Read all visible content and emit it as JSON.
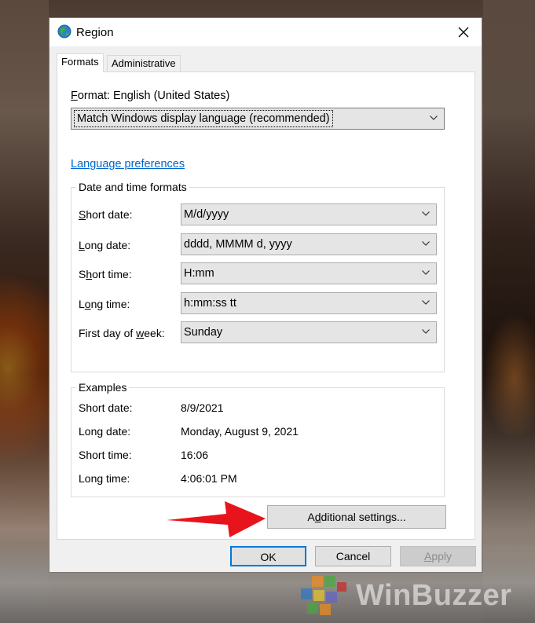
{
  "window": {
    "title": "Region",
    "icon": "globe-icon"
  },
  "tabs": [
    {
      "label": "Formats",
      "active": true
    },
    {
      "label": "Administrative",
      "active": false
    }
  ],
  "format": {
    "label_prefix": "F",
    "label_rest": "ormat: English (United States)",
    "selected": "Match Windows display language (recommended)"
  },
  "language_link": "Language preferences",
  "date_time_formats": {
    "legend": "Date and time formats",
    "rows": [
      {
        "label_pre": "",
        "label_u": "S",
        "label_post": "hort date:",
        "value": "M/d/yyyy"
      },
      {
        "label_pre": "",
        "label_u": "L",
        "label_post": "ong date:",
        "value": "dddd, MMMM d, yyyy"
      },
      {
        "label_pre": "S",
        "label_u": "h",
        "label_post": "ort time:",
        "value": "H:mm"
      },
      {
        "label_pre": "L",
        "label_u": "o",
        "label_post": "ng time:",
        "value": "h:mm:ss tt"
      },
      {
        "label_pre": "First day of ",
        "label_u": "w",
        "label_post": "eek:",
        "value": "Sunday"
      }
    ]
  },
  "examples": {
    "legend": "Examples",
    "rows": [
      {
        "label": "Short date:",
        "value": "8/9/2021"
      },
      {
        "label": "Long date:",
        "value": "Monday, August 9, 2021"
      },
      {
        "label": "Short time:",
        "value": "16:06"
      },
      {
        "label": "Long time:",
        "value": "4:06:01 PM"
      }
    ]
  },
  "buttons": {
    "additional_pre": "A",
    "additional_u": "d",
    "additional_post": "ditional settings...",
    "ok": "OK",
    "cancel": "Cancel",
    "apply_u": "A",
    "apply_post": "pply"
  },
  "watermark": "WinBuzzer",
  "colors": {
    "link": "#0066cc",
    "focus_border": "#0078d7",
    "arrow": "#e8141b"
  }
}
